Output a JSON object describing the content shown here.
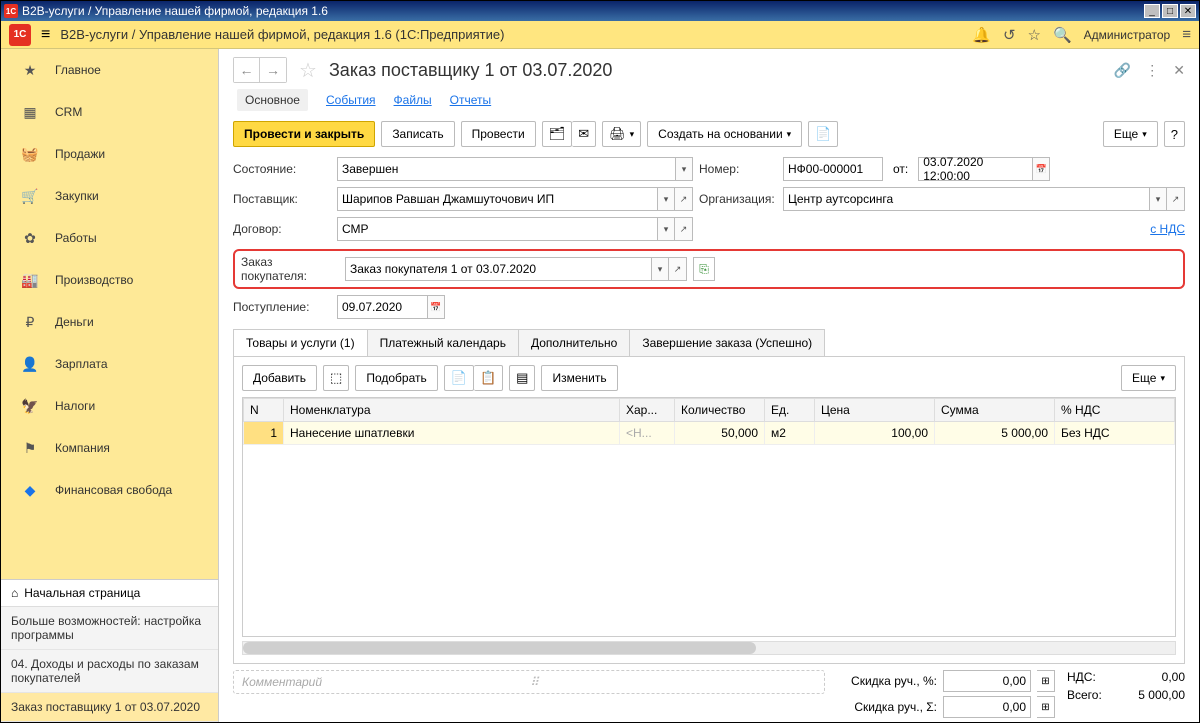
{
  "window_title": "В2В-услуги / Управление нашей фирмой, редакция 1.6",
  "app_title": "B2B-услуги / Управление нашей фирмой, редакция 1.6  (1С:Предприятие)",
  "user": "Администратор",
  "sidebar": {
    "items": [
      {
        "label": "Главное",
        "icon": "★"
      },
      {
        "label": "CRM",
        "icon": "crm"
      },
      {
        "label": "Продажи",
        "icon": "cart"
      },
      {
        "label": "Закупки",
        "icon": "cart2"
      },
      {
        "label": "Работы",
        "icon": "wrench"
      },
      {
        "label": "Производство",
        "icon": "factory"
      },
      {
        "label": "Деньги",
        "icon": "coin"
      },
      {
        "label": "Зарплата",
        "icon": "person"
      },
      {
        "label": "Налоги",
        "icon": "shield"
      },
      {
        "label": "Компания",
        "icon": "flag"
      },
      {
        "label": "Финансовая свобода",
        "icon": "diamond"
      }
    ],
    "home": "Начальная страница",
    "links": [
      "Больше возможностей: настройка программы",
      "04. Доходы и расходы по заказам покупателей",
      "Заказ поставщику 1 от 03.07.2020"
    ]
  },
  "doc": {
    "title": "Заказ поставщику 1 от 03.07.2020",
    "tabs": [
      "Основное",
      "События",
      "Файлы",
      "Отчеты"
    ],
    "toolbar": {
      "post_close": "Провести и закрыть",
      "save": "Записать",
      "post": "Провести",
      "create_based": "Создать на основании",
      "more": "Еще"
    },
    "fields": {
      "state_lbl": "Состояние:",
      "state": "Завершен",
      "number_lbl": "Номер:",
      "number": "НФ00-000001",
      "from_lbl": "от:",
      "date": "03.07.2020 12:00:00",
      "supplier_lbl": "Поставщик:",
      "supplier": "Шарипов Равшан Джамшуточович ИП",
      "org_lbl": "Организация:",
      "org": "Центр аутсорсинга",
      "contract_lbl": "Договор:",
      "contract": "СМР",
      "vat_link": "с НДС",
      "cust_order_lbl": "Заказ покупателя:",
      "cust_order": "Заказ покупателя 1 от 03.07.2020",
      "receipt_lbl": "Поступление:",
      "receipt": "09.07.2020"
    },
    "doc_tabs": [
      "Товары и услуги (1)",
      "Платежный календарь",
      "Дополнительно",
      "Завершение заказа (Успешно)"
    ],
    "tbl_toolbar": {
      "add": "Добавить",
      "pick": "Подобрать",
      "change": "Изменить",
      "more": "Еще"
    },
    "grid": {
      "cols": [
        "N",
        "Номенклатура",
        "Хар...",
        "Количество",
        "Ед.",
        "Цена",
        "Сумма",
        "% НДС"
      ],
      "rows": [
        {
          "n": "1",
          "item": "Нанесение шпатлевки",
          "char": "<Н...",
          "qty": "50,000",
          "unit": "м2",
          "price": "100,00",
          "sum": "5 000,00",
          "vat": "Без НДС"
        }
      ]
    },
    "comment_ph": "Комментарий",
    "totals": {
      "disc_pct_lbl": "Скидка руч., %:",
      "disc_pct": "0,00",
      "disc_sum_lbl": "Скидка руч., Σ:",
      "disc_sum": "0,00",
      "vat_lbl": "НДС:",
      "vat": "0,00",
      "total_lbl": "Всего:",
      "total": "5 000,00"
    }
  }
}
